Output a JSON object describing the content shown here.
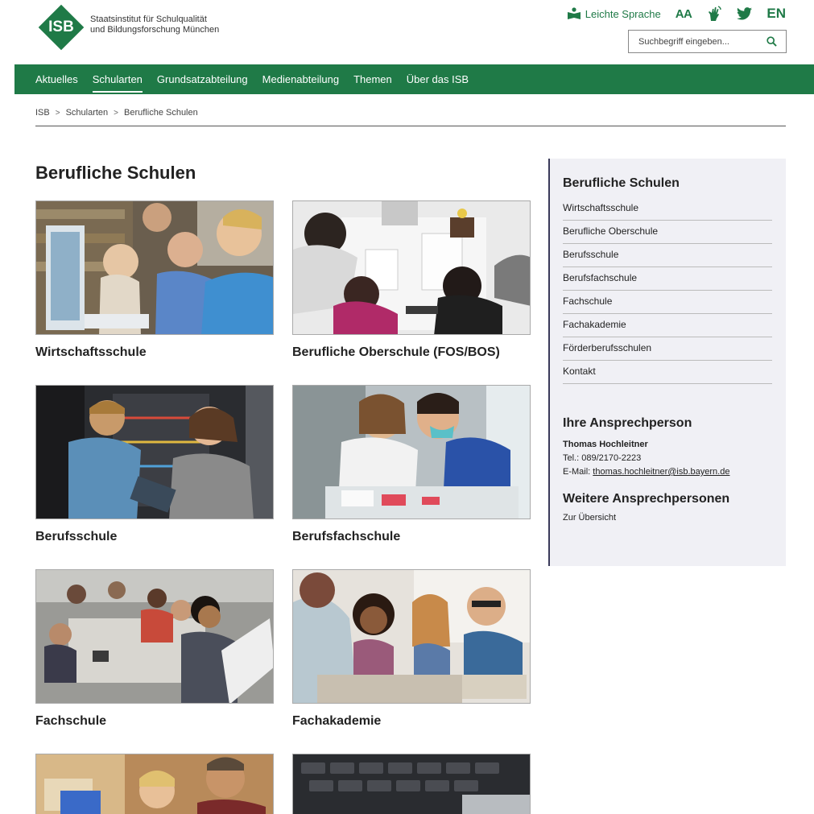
{
  "header": {
    "logo_text": "ISB",
    "institution_line1": "Staatsinstitut für Schulqualität",
    "institution_line2": "und Bildungsforschung München",
    "easy_language": "Leichte Sprache",
    "font_size_toggle": "AA",
    "language": "EN",
    "search_placeholder": "Suchbegriff eingeben..."
  },
  "nav": {
    "items": [
      "Aktuelles",
      "Schularten",
      "Grundsatzabteilung",
      "Medienabteilung",
      "Themen",
      "Über das ISB"
    ],
    "active": "Schularten"
  },
  "breadcrumb": [
    "ISB",
    "Schularten",
    "Berufliche Schulen"
  ],
  "main": {
    "title": "Berufliche Schulen",
    "cards": [
      {
        "title": "Wirtschaftsschule"
      },
      {
        "title": "Berufliche Oberschule (FOS/BOS)"
      },
      {
        "title": "Berufsschule"
      },
      {
        "title": "Berufsfachschule"
      },
      {
        "title": "Fachschule"
      },
      {
        "title": "Fachakademie"
      }
    ]
  },
  "sidebar": {
    "heading": "Berufliche Schulen",
    "items": [
      "Wirtschaftsschule",
      "Berufliche Oberschule",
      "Berufsschule",
      "Berufsfachschule",
      "Fachschule",
      "Fachakademie",
      "Förderberufsschulen",
      "Kontakt"
    ],
    "contact_heading": "Ihre Ansprechperson",
    "contact_name": "Thomas Hochleitner",
    "contact_phone": "Tel.: 089/2170-2223",
    "contact_email_label": "E-Mail:",
    "contact_email": "thomas.hochleitner@isb.bayern.de",
    "more_heading": "Weitere Ansprechpersonen",
    "more_link": "Zur Übersicht"
  },
  "colors": {
    "brand_green": "#1f7a47",
    "sidebar_bg": "#f0f0f5"
  },
  "icons": [
    "easy-language-icon",
    "font-size-icon",
    "sign-language-icon",
    "twitter-icon",
    "search-icon"
  ]
}
